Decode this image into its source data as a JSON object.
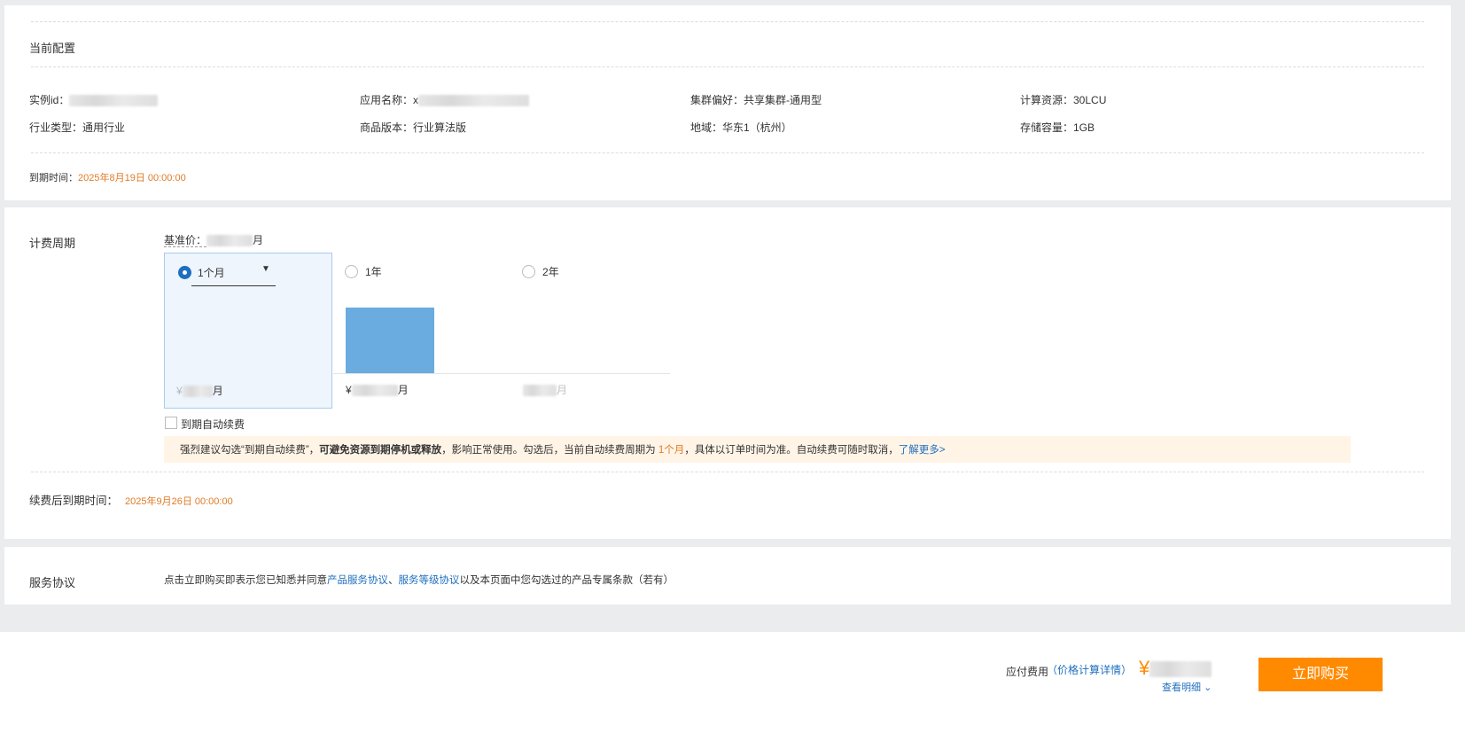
{
  "current_config": {
    "title": "当前配置",
    "instance_id_label": "实例id：",
    "app_name_label": "应用名称：",
    "app_name_prefix": "x",
    "cluster_pref": "集群偏好：共享集群-通用型",
    "compute": "计算资源：30LCU",
    "industry": "行业类型：通用行业",
    "edition": "商品版本：行业算法版",
    "region": "地域：华东1（杭州）",
    "storage": "存储容量：1GB",
    "expire_label": "到期时间：",
    "expire_value": "2025年8月19日 00:00:00"
  },
  "billing": {
    "title": "计费周期",
    "base_price_label": "基准价：",
    "base_price_suffix": "月",
    "options": [
      {
        "label": "1个月",
        "checked": true,
        "price_prefix": "¥",
        "price_suffix": "月"
      },
      {
        "label": "1年",
        "checked": false,
        "price_prefix": "¥",
        "price_suffix": "月"
      },
      {
        "label": "2年",
        "checked": false,
        "price_prefix": "",
        "price_suffix": "月"
      }
    ],
    "auto_renew_label": "到期自动续费",
    "notice_part1": "强烈建议勾选“到期自动续费”，",
    "notice_bold": "可避免资源到期停机或释放",
    "notice_part2": "，影响正常使用。勾选后，当前自动续费周期为 ",
    "notice_period": "1个月",
    "notice_part3": "，具体以订单时间为准。自动续费可随时取消，",
    "notice_link": "了解更多>",
    "renew_expire_label": "续费后到期时间：",
    "renew_expire_value": "2025年9月26日 00:00:00"
  },
  "agreement": {
    "title": "服务协议",
    "text_before": "点击立即购买即表示您已知悉并同意",
    "link1": "产品服务协议",
    "sep": "、",
    "link2": "服务等级协议",
    "text_after": "以及本页面中您勾选过的产品专属条款（若有）"
  },
  "footer": {
    "payable_label": "应付费用",
    "price_detail_link": "（价格计算详情）",
    "currency": "¥",
    "view_detail": "查看明细",
    "buy_button": "立即购买"
  },
  "colors": {
    "accent_orange": "#ff8a00",
    "link_blue": "#1f6fbf",
    "price_orange": "#e07b26",
    "selected_bg": "#eef5fd",
    "bar_blue": "#6aabe0",
    "notice_bg": "#fff4e6"
  }
}
